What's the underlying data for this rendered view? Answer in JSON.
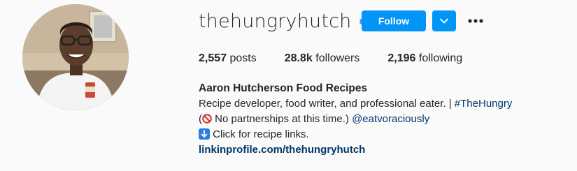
{
  "profile": {
    "username": "thehungryhutch",
    "verified": true,
    "follow_label": "Follow",
    "avatar_alt": "profile photo"
  },
  "stats": {
    "posts_count": "2,557",
    "posts_label": "posts",
    "followers_count": "28.8k",
    "followers_label": "followers",
    "following_count": "2,196",
    "following_label": "following"
  },
  "bio": {
    "name": "Aaron Hutcherson Food Recipes",
    "line1_text": "Recipe developer, food writer, and professional eater. | ",
    "line1_hashtag": "#TheHungry",
    "line2_open": "(",
    "line2_text": " No partnerships at this time.) ",
    "line2_mention": "@eatvoraciously",
    "line3_text": " Click for recipe links.",
    "link": "linkinprofile.com/thehungryhutch"
  },
  "icons": {
    "verified": "verified-badge-icon",
    "dropdown": "chevron-down-icon",
    "more": "more-options-icon",
    "no_entry": "prohibited-emoji-icon",
    "down_arrow": "down-arrow-emoji-icon"
  },
  "colors": {
    "accent": "#0095f6",
    "link": "#00376b",
    "text": "#262626",
    "background": "#fafafa"
  }
}
